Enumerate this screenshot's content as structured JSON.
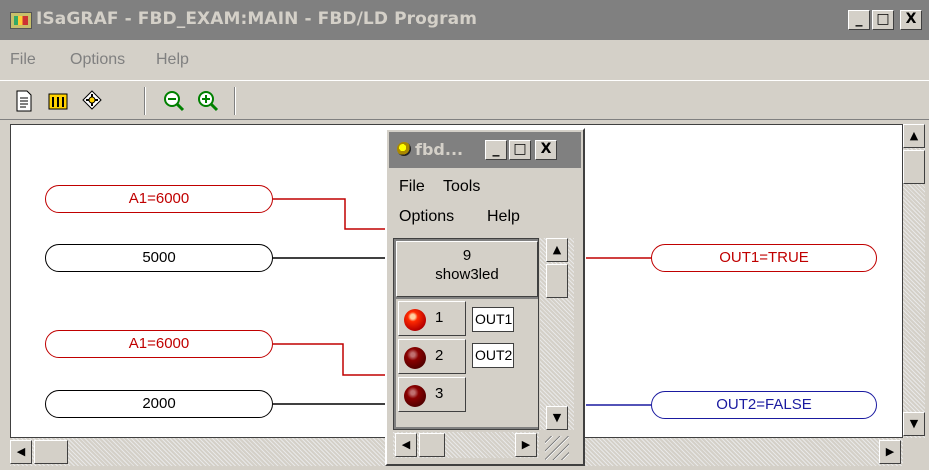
{
  "window": {
    "title": "ISaGRAF - FBD_EXAM:MAIN - FBD/LD Program",
    "minimize": "_",
    "maximize": "□",
    "close": "X"
  },
  "menu": [
    "File",
    "Options",
    "Help"
  ],
  "toolbar": [
    "document-icon",
    "chart-icon",
    "network-icon",
    "zoom-out-icon",
    "zoom-in-icon"
  ],
  "diagram": {
    "inputs": [
      {
        "label": "A1=6000",
        "color": "#c00000"
      },
      {
        "label": "5000",
        "color": "#000000"
      },
      {
        "label": "A1=6000",
        "color": "#c00000"
      },
      {
        "label": "2000",
        "color": "#000000"
      }
    ],
    "outputs": [
      {
        "label": "OUT1=TRUE",
        "color": "#c00000"
      },
      {
        "label": "OUT2=FALSE",
        "color": "#1a1aa0"
      }
    ]
  },
  "fbd_window": {
    "title": "fbd...",
    "menu_row1": [
      "File",
      "Tools"
    ],
    "menu_row2": [
      "Options",
      "Help"
    ],
    "block_number": "9",
    "block_name": "show3led",
    "leds": [
      {
        "index": "1",
        "state": "on",
        "color": "#ff2a00"
      },
      {
        "index": "2",
        "state": "off",
        "color": "#8a0000"
      },
      {
        "index": "3",
        "state": "off",
        "color": "#8a0000"
      }
    ],
    "outputs": [
      "OUT1",
      "OUT2"
    ]
  }
}
